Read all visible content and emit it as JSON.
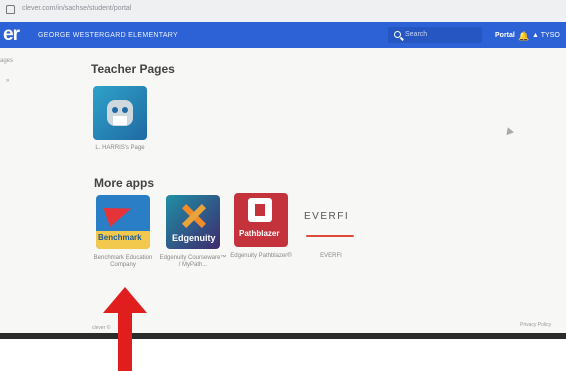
{
  "browser": {
    "url": "clever.com/in/sachse/student/portal"
  },
  "header": {
    "logo": "er",
    "school_name": "GEORGE WESTERGARD ELEMENTARY",
    "search_placeholder": "Search",
    "portal_label": "Portal",
    "user_label": "TYSO"
  },
  "sidebar": {
    "fragment_1": "ages",
    "fragment_2": "»"
  },
  "main": {
    "teacher_section_title": "Teacher Pages",
    "teacher_pages": [
      {
        "label": "L. HARRIS's Page",
        "icon": "owl-book-icon"
      }
    ],
    "more_apps_title": "More apps",
    "apps": [
      {
        "label": "Benchmark Education Company",
        "icon": "benchmark-logo",
        "logo_text": "Benchmark"
      },
      {
        "label": "Edgenuity Courseware™ / MyPath...",
        "icon": "edgenuity-logo",
        "logo_text": "Edgenuity"
      },
      {
        "label": "Edgenuity Pathblazer®",
        "icon": "pathblazer-logo",
        "logo_text": "Pathblazer"
      },
      {
        "label": "EVERFI",
        "icon": "everfi-logo",
        "logo_text": "EVERFI"
      }
    ]
  },
  "footer": {
    "left": "clever ©",
    "right": "Privacy Policy"
  },
  "annotation": {
    "color": "#e01e1e",
    "points_to": "Benchmark Education Company"
  },
  "colors": {
    "header_blue": "#2d62d6",
    "accent_red": "#e01e1e"
  }
}
